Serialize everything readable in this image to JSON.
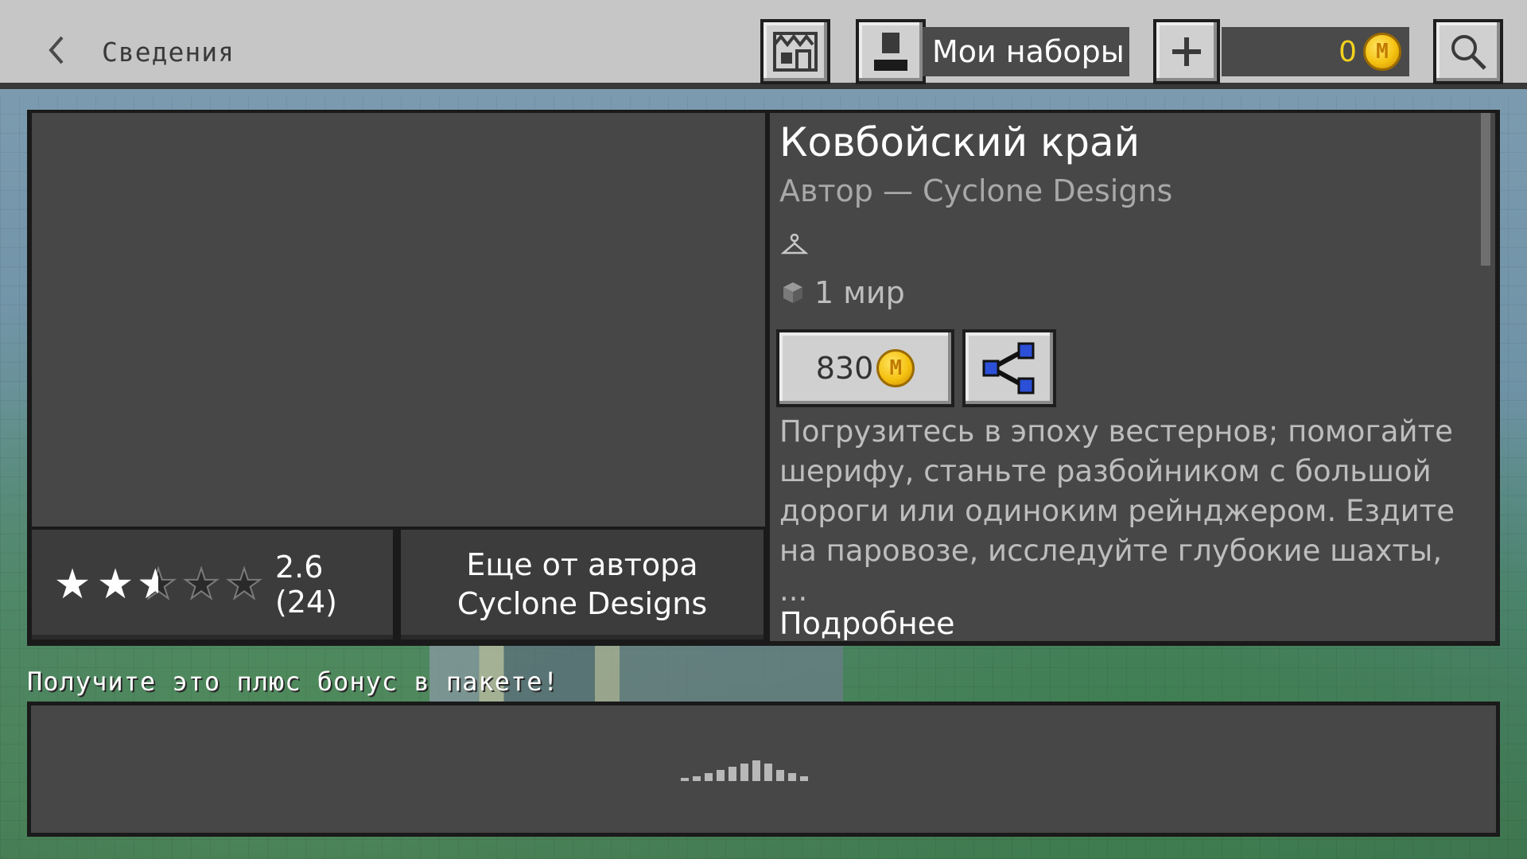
{
  "header": {
    "title": "Сведения",
    "my_packs_label": "Мои наборы",
    "coin_balance": "0",
    "icons": {
      "back": "chevron-left-icon",
      "store": "store-icon",
      "packs": "character-icon",
      "add": "plus-icon",
      "search": "search-icon"
    }
  },
  "product": {
    "title": "Ковбойский край",
    "author": "Автор — Cyclone Designs",
    "worlds": "1 мир",
    "price": "830",
    "coin_symbol": "M",
    "description": "Погрузитесь в эпоху вестернов; помогайте шерифу, станьте разбойником с большой дороги или одиноким рейнджером. Ездите на паровозе, исследуйте глубокие шахты, ...",
    "more_link": "Подробнее",
    "rating": {
      "stars": 2.6,
      "text": "2.6 (24)"
    },
    "more_from_author": "Еще от автора Cyclone Designs"
  },
  "bundle": {
    "title": "Получите это плюс бонус в пакете!"
  },
  "colors": {
    "header_bg": "#c6c6c6",
    "panel_bg": "#474747",
    "coin": "#f5c211",
    "share_node": "#2b4fd6"
  }
}
